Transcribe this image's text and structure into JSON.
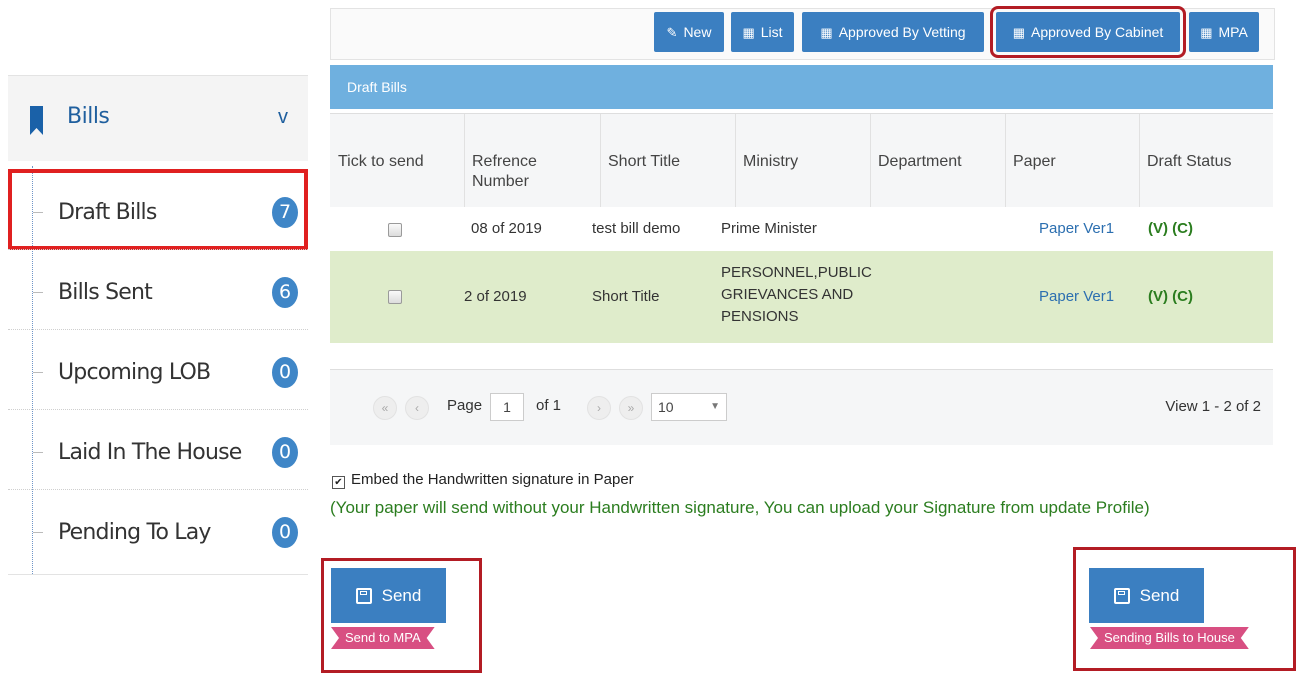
{
  "sidebar": {
    "section_title": "Bills",
    "items": [
      {
        "label": "Draft Bills",
        "count": "7"
      },
      {
        "label": "Bills Sent",
        "count": "6"
      },
      {
        "label": "Upcoming LOB",
        "count": "0"
      },
      {
        "label": "Laid In The House",
        "count": "0"
      },
      {
        "label": "Pending To Lay",
        "count": "0"
      }
    ]
  },
  "toolbar": {
    "buttons": [
      {
        "icon": "✎",
        "label": "New"
      },
      {
        "icon": "▦",
        "label": "List"
      },
      {
        "icon": "▦",
        "label": "Approved By Vetting"
      },
      {
        "icon": "▦",
        "label": "Approved By Cabinet"
      },
      {
        "icon": "▦",
        "label": "MPA"
      }
    ]
  },
  "grid": {
    "caption": "Draft Bills",
    "columns": [
      "Tick to send",
      "Refrence Number",
      "Short Title",
      "Ministry",
      "Department",
      "Paper",
      "Draft Status"
    ],
    "rows": [
      {
        "reference": "08 of 2019",
        "short_title": "test bill demo",
        "ministry": "Prime Minister",
        "department": "",
        "paper": "Paper Ver1",
        "status": "(V) (C)"
      },
      {
        "reference": "2 of 2019",
        "short_title": "Short Title",
        "ministry": "PERSONNEL,PUBLIC GRIEVANCES AND PENSIONS",
        "department": "",
        "paper": "Paper Ver1",
        "status": "(V) (C)"
      }
    ]
  },
  "pager": {
    "page_label": "Page",
    "page_value": "1",
    "of_label": "of 1",
    "page_size": "10",
    "view_text": "View 1 - 2 of 2"
  },
  "signature": {
    "checkbox_label": "Embed the Handwritten signature in Paper",
    "checked": true,
    "note": "(Your paper will send without your Handwritten signature, You can upload your Signature from update Profile)"
  },
  "actions": {
    "send_left": {
      "label": "Send",
      "ribbon": "Send to MPA"
    },
    "send_right": {
      "label": "Send",
      "ribbon": "Sending Bills to House"
    }
  },
  "colors": {
    "primary": "#3b7fc1",
    "caption": "#6fb0df",
    "highlight_row": "#dfeccb",
    "status_green": "#2b7d1f",
    "ribbon": "#d84f82",
    "annotation_red": "#e02020"
  }
}
